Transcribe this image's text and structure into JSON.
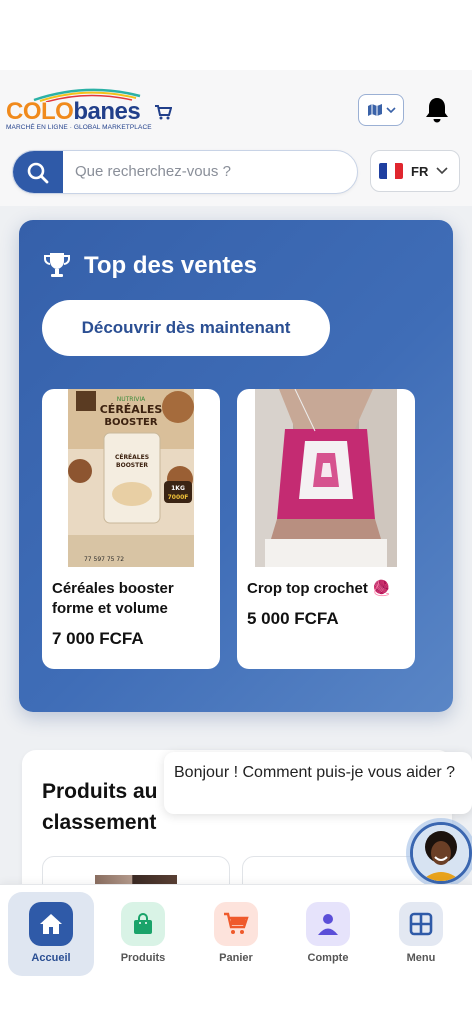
{
  "brand": {
    "name_part1": "COLO",
    "name_part2": "banes",
    "tagline": "MARCHÉ EN LIGNE · GLOBAL MARKETPLACE",
    "colors": {
      "primary": "#2f5aa8",
      "accent": "#f08a1c",
      "dark": "#213f8a"
    }
  },
  "header": {
    "map_button_icon": "map-icon",
    "notification_icon": "bell-icon"
  },
  "search": {
    "icon": "search-icon",
    "placeholder": "Que recherchez-vous ?"
  },
  "language": {
    "code": "FR",
    "flag": "france-flag-icon"
  },
  "top_sales": {
    "title": "Top des ventes",
    "icon": "trophy-icon",
    "cta_label": "Découvrir dès maintenant",
    "products": [
      {
        "name": "Céréales booster forme et volume",
        "price": "7 000 FCFA"
      },
      {
        "name": "Crop top crochet 🧶",
        "price": "5 000 FCFA"
      }
    ]
  },
  "ranking": {
    "title": "Produits au classement"
  },
  "chat": {
    "message": "Bonjour ! Comment puis-je vous aider ?"
  },
  "bottom_nav": [
    {
      "label": "Accueil",
      "icon": "home-icon",
      "active": true
    },
    {
      "label": "Produits",
      "icon": "shopping-bag-icon",
      "active": false
    },
    {
      "label": "Panier",
      "icon": "cart-icon",
      "active": false
    },
    {
      "label": "Compte",
      "icon": "user-icon",
      "active": false
    },
    {
      "label": "Menu",
      "icon": "grid-icon",
      "active": false
    }
  ]
}
